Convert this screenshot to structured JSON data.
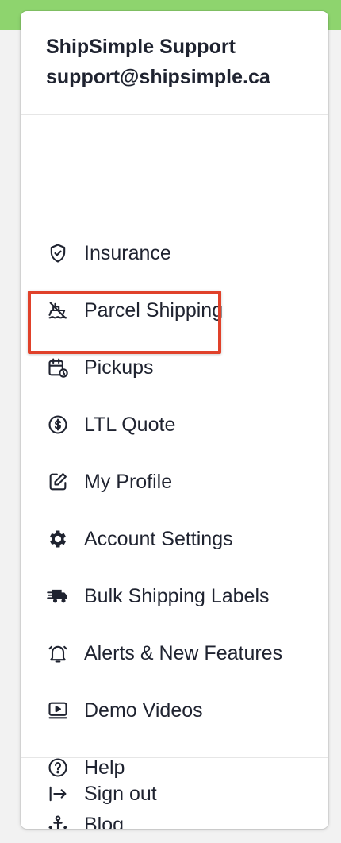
{
  "header": {
    "name": "ShipSimple Support",
    "email": "support@shipsimple.ca"
  },
  "menu_items": [
    {
      "label": "Insurance",
      "icon": "shield-icon"
    },
    {
      "label": "Parcel Shipping",
      "icon": "ship-icon"
    },
    {
      "label": "Pickups",
      "icon": "calendar-clock-icon"
    },
    {
      "label": "LTL Quote",
      "icon": "dollar-circle-icon",
      "highlighted": true
    },
    {
      "label": "My Profile",
      "icon": "edit-icon"
    },
    {
      "label": "Account Settings",
      "icon": "gear-icon"
    },
    {
      "label": "Bulk Shipping Labels",
      "icon": "truck-fast-icon"
    },
    {
      "label": "Alerts & New Features",
      "icon": "bell-icon"
    },
    {
      "label": "Demo Videos",
      "icon": "video-icon"
    },
    {
      "label": "Help",
      "icon": "help-circle-icon"
    },
    {
      "label": "Blog",
      "icon": "anchor-icon"
    }
  ],
  "footer": {
    "sign_out_label": "Sign out",
    "icon": "sign-out-icon"
  },
  "colors": {
    "top_strip": "#8ed46e",
    "highlight_border": "#e0412a",
    "text": "#1f2330"
  }
}
